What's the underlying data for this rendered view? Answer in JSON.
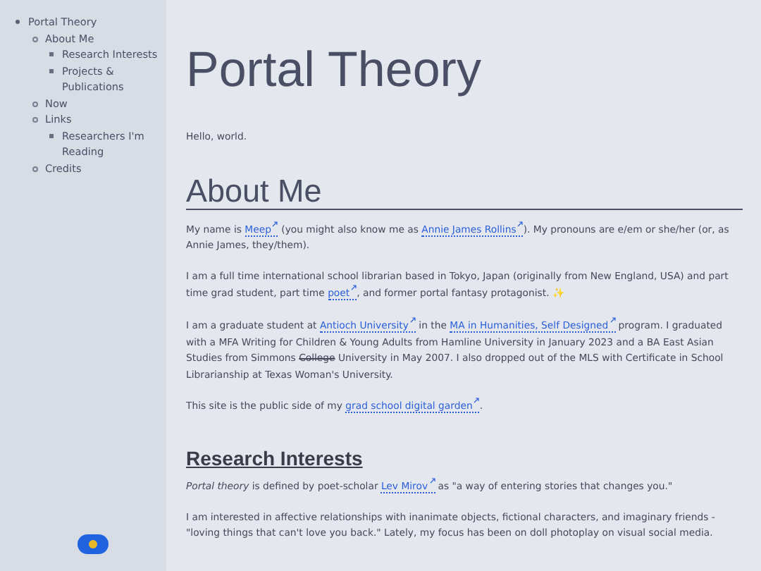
{
  "sidebar": {
    "items": [
      {
        "label": "Portal Theory",
        "children": [
          {
            "label": "About Me",
            "children": [
              {
                "label": "Research Interests"
              },
              {
                "label": "Projects & Publications"
              }
            ]
          },
          {
            "label": "Now"
          },
          {
            "label": "Links",
            "children": [
              {
                "label": "Researchers I'm Reading"
              }
            ]
          },
          {
            "label": "Credits"
          }
        ]
      }
    ],
    "theme_toggle": {
      "on": false
    }
  },
  "page": {
    "title": "Portal Theory",
    "intro": "Hello, world.",
    "sections": [
      {
        "kind": "h1",
        "heading": "About Me",
        "paragraphs": [
          [
            {
              "kind": "text",
              "text": "My name is "
            },
            {
              "kind": "link",
              "text": "Meep"
            },
            {
              "kind": "text",
              "text": " (you might also know me as "
            },
            {
              "kind": "link",
              "text": "Annie James Rollins"
            },
            {
              "kind": "text",
              "text": "). My pronouns are e/em or she/her (or, as Annie James, they/them)."
            }
          ],
          [
            {
              "kind": "text",
              "text": "I am a full time international school librarian based in Tokyo, Japan (originally from New England, USA) and part time grad student, part time "
            },
            {
              "kind": "link",
              "text": "poet"
            },
            {
              "kind": "text",
              "text": ", and former portal fantasy protagonist. ✨"
            }
          ],
          [
            {
              "kind": "text",
              "text": "I am a graduate student at "
            },
            {
              "kind": "link",
              "text": "Antioch University"
            },
            {
              "kind": "text",
              "text": " in the "
            },
            {
              "kind": "link",
              "text": "MA in Humanities, Self Designed"
            },
            {
              "kind": "text",
              "text": " program. I graduated with a MFA Writing for Children & Young Adults from Hamline University in January 2023 and a BA East Asian Studies from Simmons "
            },
            {
              "kind": "strike",
              "text": "College"
            },
            {
              "kind": "text",
              "text": " University in May 2007. I also dropped out of the MLS with Certificate in School Librarianship at Texas Woman's University."
            }
          ],
          [
            {
              "kind": "text",
              "text": "This site is the public side of my "
            },
            {
              "kind": "link",
              "text": "grad school digital garden"
            },
            {
              "kind": "text",
              "text": "."
            }
          ]
        ]
      },
      {
        "kind": "h2",
        "heading": "Research Interests",
        "paragraphs": [
          [
            {
              "kind": "em",
              "text": "Portal theory"
            },
            {
              "kind": "text",
              "text": " is defined by poet-scholar "
            },
            {
              "kind": "link",
              "text": "Lev Mirov"
            },
            {
              "kind": "text",
              "text": " as \"a way of entering stories that changes you.\""
            }
          ],
          [
            {
              "kind": "text",
              "text": "I am interested in affective relationships with inanimate objects, fictional characters, and imaginary friends - \"loving things that can't love you back.\" Lately, my focus has been on doll photoplay on visual social media."
            }
          ]
        ]
      }
    ]
  }
}
